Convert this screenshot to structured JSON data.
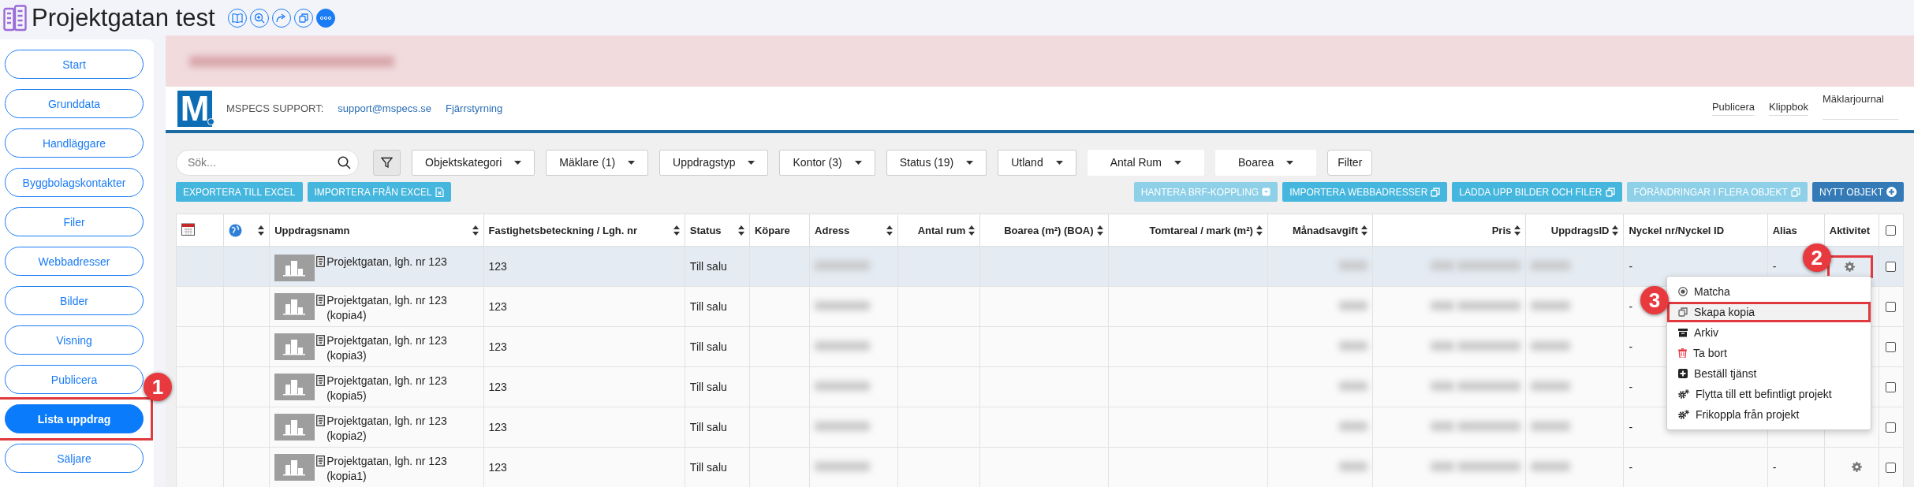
{
  "app": {
    "title": "Projektgatan test"
  },
  "sidebar": {
    "items": [
      {
        "label": "Start",
        "selected": false
      },
      {
        "label": "Grunddata",
        "selected": false
      },
      {
        "label": "Handläggare",
        "selected": false
      },
      {
        "label": "Byggbolagskontakter",
        "selected": false
      },
      {
        "label": "Filer",
        "selected": false
      },
      {
        "label": "Webbadresser",
        "selected": false
      },
      {
        "label": "Bilder",
        "selected": false
      },
      {
        "label": "Visning",
        "selected": false
      },
      {
        "label": "Publicera",
        "selected": false
      },
      {
        "label": "Lista uppdrag",
        "selected": true,
        "callout": "1"
      },
      {
        "label": "Säljare",
        "selected": false
      }
    ]
  },
  "header": {
    "logo_text": "M",
    "support_label": "MSPECS SUPPORT:",
    "links": [
      "support@mspecs.se",
      "Fjärrstyrning"
    ],
    "nav": [
      "Publicera",
      "Klippbok",
      "Mäklarjournal"
    ]
  },
  "search": {
    "placeholder": "Sök..."
  },
  "filters": [
    {
      "label": "Objektskategori",
      "kind": "dropdown"
    },
    {
      "label": "Mäklare (1)",
      "kind": "dropdown"
    },
    {
      "label": "Uppdragstyp",
      "kind": "dropdown"
    },
    {
      "label": "Kontor (3)",
      "kind": "dropdown"
    },
    {
      "label": "Status (19)",
      "kind": "dropdown"
    },
    {
      "label": "Utland",
      "kind": "dropdown"
    },
    {
      "label": "Antal Rum",
      "kind": "plain"
    },
    {
      "label": "Boarea",
      "kind": "plain"
    },
    {
      "label": "Filter",
      "kind": "button"
    }
  ],
  "actions_left": [
    {
      "label": "EXPORTERA TILL EXCEL",
      "kind": "plain",
      "disabled": false
    },
    {
      "label": "IMPORTERA FRÅN EXCEL",
      "kind": "excel",
      "disabled": false
    }
  ],
  "actions_right": [
    {
      "label": "HANTERA BRF-KOPPLING",
      "kind": "dropdown",
      "disabled": true
    },
    {
      "label": "IMPORTERA WEBBADRESSER",
      "kind": "copy",
      "disabled": false
    },
    {
      "label": "LADDA UPP BILDER OCH FILER",
      "kind": "copy",
      "disabled": false
    },
    {
      "label": "FÖRÄNDRINGAR I FLERA OBJEKT",
      "kind": "copy",
      "disabled": true
    },
    {
      "label": "NYTT OBJEKT",
      "kind": "add",
      "disabled": false
    }
  ],
  "table": {
    "columns": [
      {
        "kind": "calendar"
      },
      {
        "kind": "globe",
        "sortable": true
      },
      {
        "label": "Uppdragsnamn",
        "sortable": true
      },
      {
        "label": "Fastighetsbeteckning / Lgh. nr",
        "sortable": true
      },
      {
        "label": "Status",
        "sortable": true
      },
      {
        "label": "Köpare",
        "sortable": false
      },
      {
        "label": "Adress",
        "sortable": true
      },
      {
        "label": "Antal rum",
        "sortable": true
      },
      {
        "label": "Boarea (m²) (BOA)",
        "sortable": true
      },
      {
        "label": "Tomtareal / mark (m²)",
        "sortable": true
      },
      {
        "label": "Månadsavgift",
        "sortable": true
      },
      {
        "label": "Pris",
        "sortable": true
      },
      {
        "label": "UppdragsID",
        "sortable": true
      },
      {
        "label": "Nyckel nr/Nyckel ID",
        "sortable": false
      },
      {
        "label": "Alias",
        "sortable": false
      },
      {
        "label": "Aktivitet",
        "sortable": false
      },
      {
        "kind": "checkbox",
        "checked": false
      }
    ],
    "rows": [
      {
        "name": "Projektgatan, lgh. nr 123",
        "property": "123",
        "status": "Till salu",
        "key": "-",
        "alias": "-",
        "activity_button": true,
        "activity_callout": "2",
        "checked": false,
        "selected": true
      },
      {
        "name": "Projektgatan, lgh. nr 123 (kopia4)",
        "property": "123",
        "status": "Till salu",
        "key": "-",
        "activity_button": false,
        "checked": false,
        "selected": false
      },
      {
        "name": "Projektgatan, lgh. nr 123 (kopia3)",
        "property": "123",
        "status": "Till salu",
        "key": "-",
        "activity_button": false,
        "checked": false,
        "selected": false
      },
      {
        "name": "Projektgatan, lgh. nr 123 (kopia5)",
        "property": "123",
        "status": "Till salu",
        "key": "-",
        "activity_button": false,
        "checked": false,
        "selected": false
      },
      {
        "name": "Projektgatan, lgh. nr 123 (kopia2)",
        "property": "123",
        "status": "Till salu",
        "key": "-",
        "activity_button": false,
        "checked": false,
        "selected": false
      },
      {
        "name": "Projektgatan, lgh. nr 123 (kopia1)",
        "property": "123",
        "status": "Till salu",
        "key": "-",
        "alias": "-",
        "activity_button": true,
        "checked": false,
        "selected": false
      }
    ]
  },
  "context_menu": {
    "items": [
      {
        "label": "Matcha",
        "kind": "match",
        "selected": false
      },
      {
        "label": "Skapa kopia",
        "kind": "copy",
        "selected": true,
        "callout": "3"
      },
      {
        "label": "Arkiv",
        "kind": "archive",
        "selected": false
      },
      {
        "label": "Ta bort",
        "kind": "delete",
        "selected": false
      },
      {
        "label": "Beställ tjänst",
        "kind": "order",
        "selected": false
      },
      {
        "label": "Flytta till ett befintligt projekt",
        "kind": "move",
        "selected": false
      },
      {
        "label": "Frikoppla från projekt",
        "kind": "move",
        "selected": false
      }
    ]
  }
}
